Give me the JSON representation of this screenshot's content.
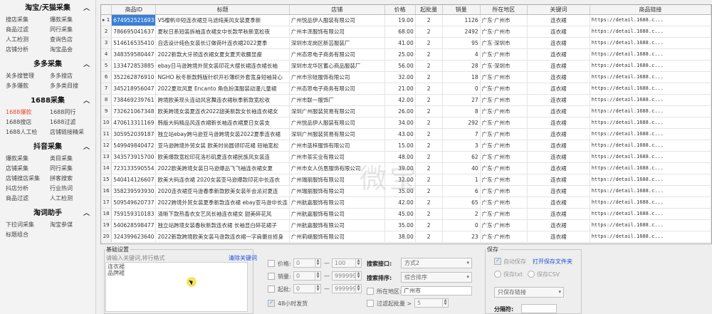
{
  "sidebar": {
    "sections": [
      {
        "title": "淘宝/天猫采集",
        "toggle": "︿",
        "items": [
          "搜店采集",
          "爆款采集",
          "商品过滤",
          "同行采集",
          "人工检测",
          "查询告店",
          "店铺分析",
          "淘宝品会"
        ],
        "active": -1
      },
      {
        "title": "多多采集",
        "toggle": "︿",
        "items": [
          "关多搜管理",
          "多多搜店",
          "多多爆款",
          "多多类目搜"
        ],
        "active": -1
      },
      {
        "title": "1688采集",
        "toggle": "︿",
        "items": [
          "1688爆款",
          "1688同行",
          "1688搜店",
          "1688过滤",
          "1688人工检",
          "店铺链接精采"
        ],
        "active": 0
      },
      {
        "title": "抖音采集",
        "toggle": "︿",
        "items": [
          "爆款采集",
          "类目采集",
          "店铺采集",
          "同行采集",
          "店铺搜店采集",
          "拼客搜索",
          "抖店分析",
          "行业热词",
          "商品过滤",
          "人工检测"
        ],
        "active": -1
      },
      {
        "title": "淘词助手",
        "toggle": "︿",
        "items": [
          "下拉词采集",
          "淘宝参谋",
          "标题组合"
        ],
        "active": -1
      }
    ]
  },
  "table": {
    "columns": [
      "商品ID",
      "标题",
      "店铺",
      "价格",
      "起批量",
      "销量",
      "所在地区",
      "关键词",
      "商品链接"
    ],
    "rows": [
      [
        "674952521693",
        "VS樱帆中短连衣裙豆马滤纯美风女装夏季新",
        "广州悦品伊人服装有限公司",
        "19.00",
        "2",
        "1126",
        "广东·广州市",
        "连衣裙",
        "https://detail.1688.c..."
      ],
      [
        "786695041637",
        "夏秋日系短装拆袖连衣裙女中长款早秋新宽松夜",
        "广州丰泽服饰有限公司",
        "68.00",
        "2",
        "2492",
        "广东·广州市",
        "连衣裙",
        "https://detail.1688.c..."
      ],
      [
        "514616535410",
        "自选设计纯色女装长订做荷叶连衣裙2022夏季",
        "深圳市龙岗区新芸服装厂",
        "41.00",
        "2",
        "95",
        "广东·深圳市",
        "连衣裙",
        "https://detail.1688.c..."
      ],
      [
        "348359580447",
        "2022新款大牙领连衣裙女夏女夏天收腰显瘦",
        "广州态思电子商务有限公司",
        "25.00",
        "2",
        "4",
        "广东·广州市",
        "连衣裙",
        "https://detail.1688.c..."
      ],
      [
        "133472853885",
        "ebay日马逊跨境外贸女装印花大摆长裙连衣裙长袖",
        "深圳市龙华区蓄心商品服装厂",
        "56.00",
        "2",
        "28",
        "广东·深圳市",
        "连衣裙",
        "https://detail.1688.c..."
      ],
      [
        "352262876910",
        "NGHO 秋冬新款韩版针织开衫薄织外套宽身短袖背心",
        "广州市宗硅服饰有限公司",
        "32.00",
        "2",
        "18",
        "广东·广州市",
        "连衣裙",
        "https://detail.1688.c..."
      ],
      [
        "345218956047",
        "2022夏欢风夏 Encanto 角色扮演服装动漫儿童裙",
        "广州态思电子商务有限公司",
        "21.00",
        "2",
        "0",
        "广东·广州市",
        "连衣裙",
        "https://detail.1688.c..."
      ],
      [
        "738469239761",
        "跨境欧美现头连动风宫舞连衣裙秋季新款宽松收",
        "广州市联一服饰厂",
        "42.00",
        "2",
        "27",
        "广东·广州市",
        "连衣裙",
        "https://detail.1688.c..."
      ],
      [
        "732621067348",
        "欧美跨境女装夏连衣2022甜美新款女长袖连衣裙女",
        "深圳广州服装贸易有限公司",
        "26.00",
        "2",
        "8",
        "广东·广州市",
        "连衣裙",
        "https://detail.1688.c..."
      ],
      [
        "470613311169",
        "韩版大码精品风连衣裙新长袖连衣裙夏日女装支",
        "广州悦品伊人服装有限公司",
        "34.00",
        "2",
        "292",
        "广东·广州市",
        "连衣裙",
        "https://detail.1688.c..."
      ],
      [
        "305952039187",
        "独立站ebay跨马逊亚马逊跨境女装2022夏季连衣裙",
        "深圳广州服装贸易有限公司",
        "43.00",
        "2",
        "7",
        "广东·广州市",
        "连衣裙",
        "https://detail.1688.c..."
      ],
      [
        "549949840472",
        "亚马逊跨境外贸女装 欧美时尚圆领印花裙 短袖宽松",
        "广州市蓝梓服饰有限公司",
        "15.00",
        "2",
        "3",
        "广东·广州市",
        "连衣裙",
        "https://detail.1688.c..."
      ],
      [
        "343573915700",
        "欧美爆款宽松印花洛杉矶夏连衣裙民族风女装连",
        "广州市茶实业有限公司",
        "48.00",
        "2",
        "62",
        "广东·广州市",
        "连衣裙",
        "https://detail.1688.c..."
      ],
      [
        "723133590554",
        "2022欧美跨境女装日马逊爆品飞飞袖连衣裙女夏",
        "广州市女人仿恩服饰有限公司",
        "39.00",
        "2",
        "40",
        "广东·广州市",
        "连衣裙",
        "https://detail.1688.c..."
      ],
      [
        "540414126607",
        "欧美大码连衣裙 2020女装亚马逊爆款印花中长连衣",
        "广州瑞丽服饰有限公司",
        "32.00",
        "2",
        "1",
        "广东·广州市",
        "连衣裙",
        "https://detail.1688.c..."
      ],
      [
        "358239593930",
        "2020连衣裙亚马逊春季新款欧美女装年会派对夏连",
        "广州瑞丽服饰有限公司",
        "35.00",
        "2",
        "6",
        "广东·广州市",
        "连衣裙",
        "https://detail.1688.c..."
      ],
      [
        "509549620737",
        "2022跨境外贸女装夏季新款连衣裙 ebay亚马逊中长连",
        "广州航嘉服饰有限公司",
        "42.00",
        "2",
        "65",
        "广东·广州市",
        "连衣裙",
        "https://detail.1688.c..."
      ],
      [
        "759159310183",
        "清晰下款热香衣女艺风长袖连衣裙女 甜美碎花风",
        "广州航嘉服饰有限公司",
        "45.00",
        "2",
        "2",
        "广东·广州市",
        "连衣裙",
        "https://detail.1688.c..."
      ],
      [
        "540628598477",
        "独立站跨境女装春秋新款连衣裙 长袖显白碎花裙子",
        "广州航嘉服饰有限公司",
        "35.00",
        "2",
        "0",
        "广东·广州市",
        "连衣裙",
        "https://detail.1688.c..."
      ],
      [
        "324399623640",
        "2022新款跨境欧美女装马逊款连衣裙一字肩蕾丝修身",
        "广州莉缇服饰有限公司",
        "38.00",
        "2",
        "23",
        "广东·广州市",
        "连衣裙",
        "https://detail.1688.c..."
      ]
    ]
  },
  "watermark": "微宝",
  "settings": {
    "legend": "基础设置",
    "keyword_hint": "请输入关键词,将行格式",
    "clear_link": "清除关键词",
    "keywords": [
      "连衣裙",
      "品牌裙"
    ],
    "price_label": "价格:",
    "price_min": "0",
    "price_max": "100",
    "sales_label": "销量:",
    "sales_min": "0",
    "sales_max": "999999",
    "moq_label": "起批:",
    "moq_min": "0",
    "moq_max": "999999",
    "hours_label": "48小时发货",
    "dash": "—",
    "api_label": "搜索接口:",
    "api_value": "方式2",
    "sort_label": "搜索排序:",
    "sort_value": "综合排序",
    "region_label": "所在地区:",
    "region_value": "广州市",
    "filter_moq_label": "过滤起批量 >",
    "filter_moq_value": "5"
  },
  "save": {
    "legend": "保存",
    "auto_save": "自动保存",
    "open_folder": "打开保存文件夹",
    "save_txt": "保存txt",
    "save_csv": "保存CSV",
    "mode_value": "只保存链接",
    "split_label": "分隔符:"
  },
  "icons": {
    "row_pointer": "row-pointer-icon",
    "checkbox": "checkbox-icon",
    "dropdown": "chevron-down-icon"
  }
}
